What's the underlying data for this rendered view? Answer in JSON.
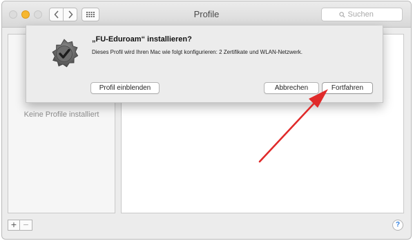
{
  "window": {
    "title": "Profile",
    "search": {
      "placeholder": "Suchen",
      "value": ""
    }
  },
  "toolbar": {
    "back_icon": "chevron-left-icon",
    "forward_icon": "chevron-right-icon",
    "grid_icon": "grid-icon"
  },
  "sidebar": {
    "empty_label": "Keine Profile installiert"
  },
  "bottom_bar": {
    "add_label": "+",
    "remove_label": "−",
    "help_label": "?"
  },
  "dialog": {
    "icon": "gear-check-icon",
    "title": "„FU-Eduroam“ installieren?",
    "message": "Dieses Profil wird Ihren Mac wie folgt konfigurieren: 2 Zertifikate und WLAN-Netzwerk.",
    "show_profile_label": "Profil einblenden",
    "cancel_label": "Abbrechen",
    "continue_label": "Fortfahren"
  },
  "annotation": {
    "color": "#e02a2a"
  }
}
